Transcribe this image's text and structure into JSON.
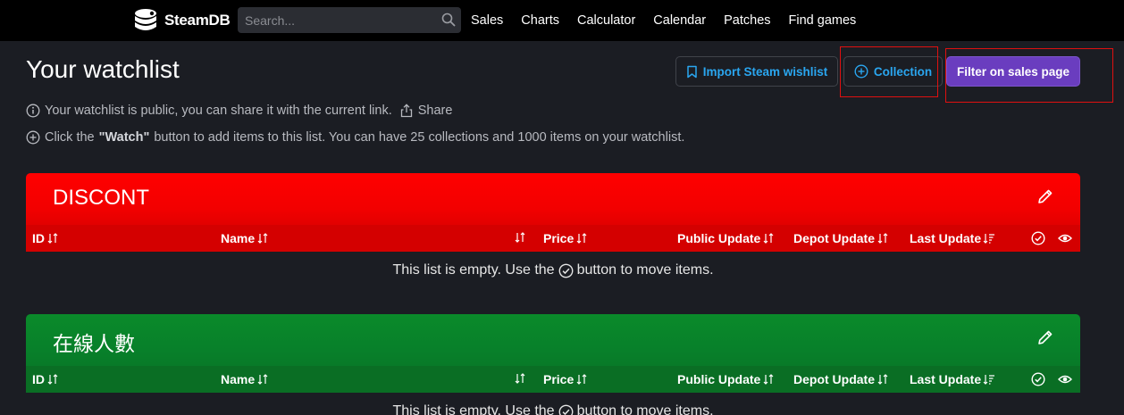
{
  "nav": {
    "logo_text": "SteamDB",
    "search_placeholder": "Search...",
    "links": [
      "Sales",
      "Charts",
      "Calculator",
      "Calendar",
      "Patches",
      "Find games"
    ]
  },
  "header": {
    "title": "Your watchlist",
    "info_public": "Your watchlist is public, you can share it with the current link.",
    "share_label": "Share",
    "info_click_prefix": "Click the",
    "info_click_bold": "\"Watch\"",
    "info_click_suffix": "button to add items to this list. You can have 25 collections and 1000 items on your watchlist."
  },
  "buttons": {
    "import_label": "Import Steam wishlist",
    "collection_label": "Collection",
    "filter_label": "Filter on sales page"
  },
  "columns": {
    "id": "ID",
    "name": "Name",
    "price": "Price",
    "public_update": "Public Update",
    "depot_update": "Depot Update",
    "last_update": "Last Update"
  },
  "lists": [
    {
      "name": "DISCONT",
      "empty_prefix": "This list is empty. Use the",
      "empty_suffix": "button to move items."
    },
    {
      "name": "在線人數",
      "empty_prefix": "This list is empty. Use the",
      "empty_suffix": "button to move items."
    }
  ],
  "colors": {
    "accent_blue": "#2aa6f0",
    "filter_purple": "#6a3dbf",
    "list_red": "#ff0000",
    "list_green": "#0a8a2a"
  },
  "icons": {
    "logo": "steamdb-logo-icon",
    "search": "search-icon",
    "info": "info-icon",
    "share": "share-icon",
    "plus": "plus-circle-icon",
    "bookmark": "bookmark-icon",
    "edit": "pencil-icon",
    "sort": "sort-icon",
    "check": "check-circle-icon",
    "eye": "eye-icon"
  }
}
